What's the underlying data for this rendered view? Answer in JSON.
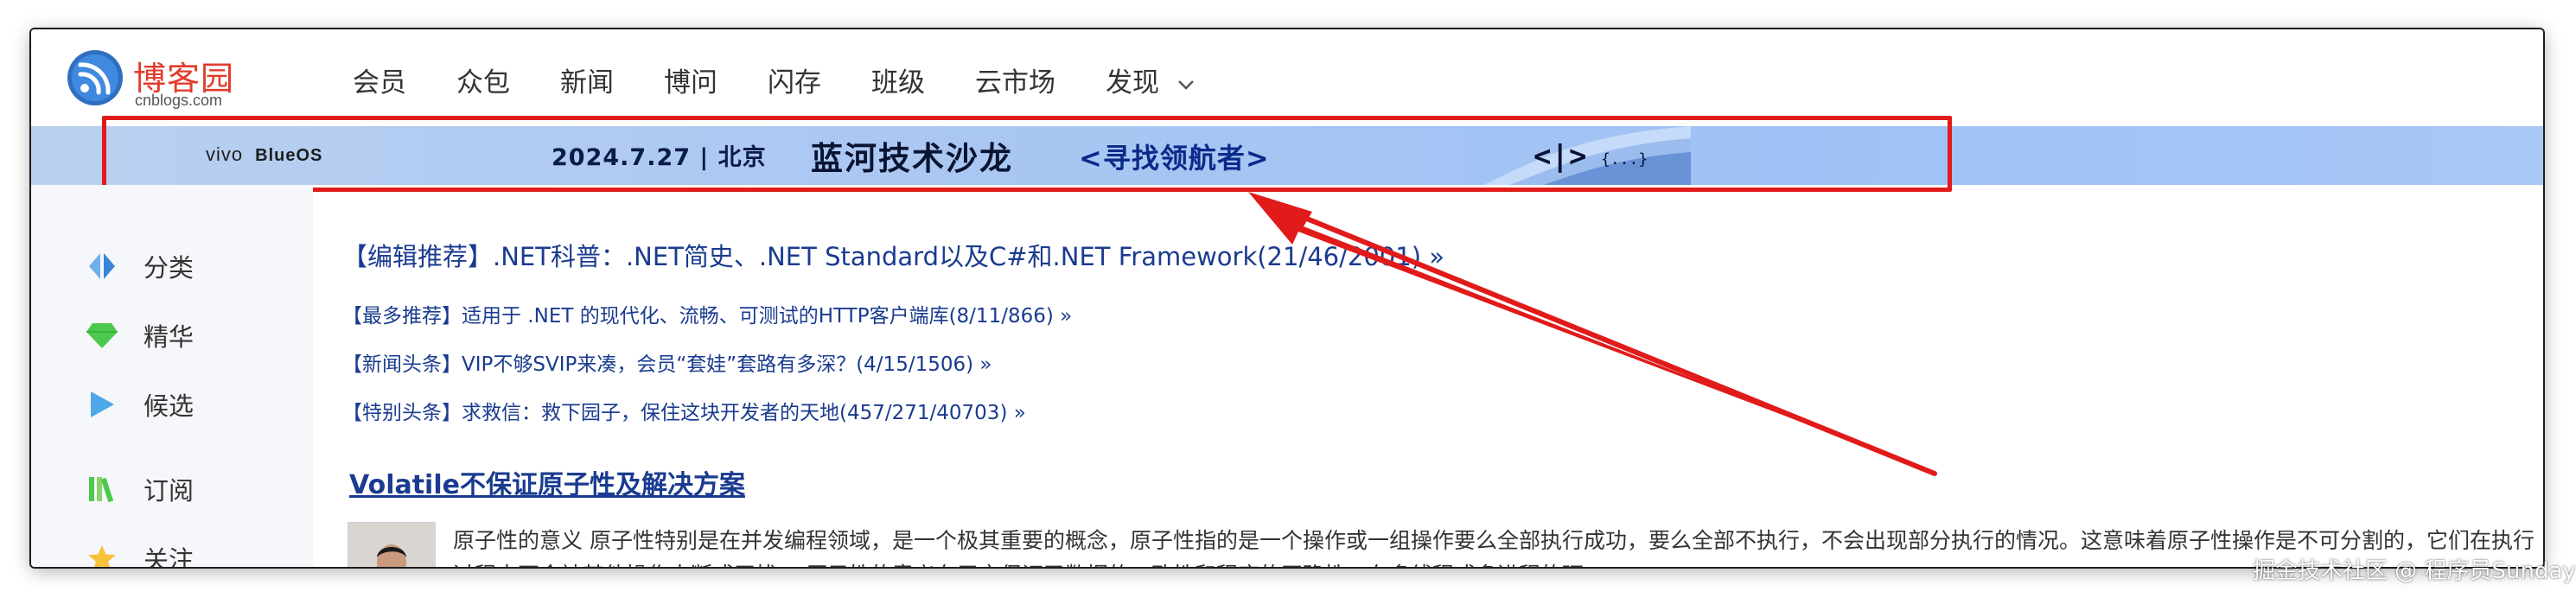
{
  "header": {
    "logo_cn": "博客园",
    "logo_en": "cnblogs.com",
    "nav": [
      {
        "label": "会员"
      },
      {
        "label": "众包"
      },
      {
        "label": "新闻"
      },
      {
        "label": "博问"
      },
      {
        "label": "闪存"
      },
      {
        "label": "班级"
      },
      {
        "label": "云市场"
      },
      {
        "label": "发现"
      }
    ]
  },
  "banner": {
    "brand": "vivo",
    "brand_os": "BlueOS",
    "date": "2024.7.27 | 北京",
    "title": "蓝河技术沙龙",
    "subtitle": "<寻找领航者>",
    "highlight_color": "#e11a1a"
  },
  "sidebar": {
    "items": [
      {
        "label": "分类",
        "icon": "category-icon"
      },
      {
        "label": "精华",
        "icon": "gem-icon"
      },
      {
        "label": "候选",
        "icon": "play-icon"
      },
      {
        "label": "订阅",
        "icon": "books-icon"
      },
      {
        "label": "关注",
        "icon": "star-icon"
      }
    ]
  },
  "main": {
    "headlines": [
      {
        "text": "【编辑推荐】.NET科普：.NET简史、.NET Standard以及C#和.NET Framework(21/46/2001) »"
      },
      {
        "text": "【最多推荐】适用于 .NET 的现代化、流畅、可测试的HTTP客户端库(8/11/866) »"
      },
      {
        "text": "【新闻头条】VIP不够SVIP来凑，会员“套娃”套路有多深？(4/15/1506) »"
      },
      {
        "text": "【特别头条】求救信：救下园子，保住这块开发者的天地(457/271/40703) »"
      }
    ],
    "post": {
      "title": "Volatile不保证原子性及解决方案",
      "summary": "原子性的意义 原子性特别是在并发编程领域，是一个极其重要的概念，原子性指的是一个操作或一组操作要么全部执行成功，要么全部不执行，不会出现部分执行的情况。这意味着原子性操作是不可分割的，它们在执行过程中不会被其他操作中断或干扰。 原子性的意义在于它保证了数据的一致性和程序的正确性。在多线程或多进程的环 ..."
    }
  },
  "watermark": "掘金技术社区 @ 程序员Sunday",
  "colors": {
    "link": "#1a3b8f",
    "logo_red": "#e03c2c",
    "banner_blue": "#a9c6f2",
    "annotation_red": "#e11a1a"
  }
}
